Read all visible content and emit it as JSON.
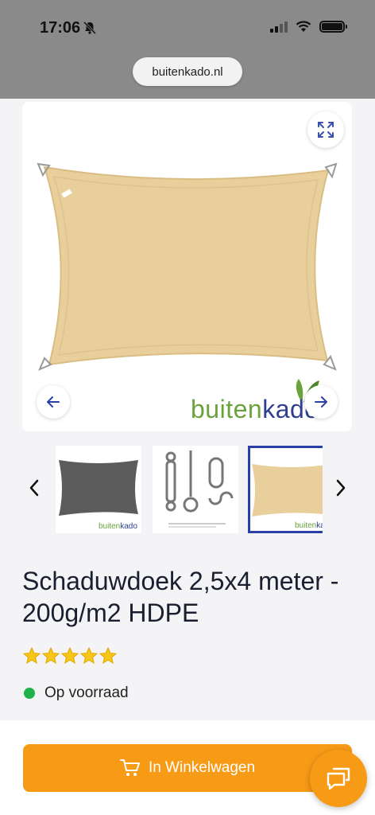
{
  "status_bar": {
    "time": "17:06"
  },
  "browser": {
    "url": "buitenkado.nl"
  },
  "gallery": {
    "logo_part1": "buiten",
    "logo_part2": "kado",
    "thumbnails": [
      {
        "logo_part1": "buiten",
        "logo_part2": "kado"
      },
      {
        "caption": ""
      },
      {
        "logo_part1": "buiten",
        "logo_part2": "kado"
      }
    ],
    "selected_thumbnail": 3
  },
  "product": {
    "title": "Schaduwdoek 2,5x4 meter - 200g/m2 HDPE",
    "rating": 5,
    "stock_status": "Op voorraad"
  },
  "actions": {
    "add_to_cart_label": "In Winkelwagen"
  },
  "colors": {
    "accent": "#f79a16",
    "in_stock": "#1fb24a",
    "brand_green": "#6aa23c",
    "brand_blue": "#2f3f8e",
    "selected_border": "#2b3fa8"
  }
}
